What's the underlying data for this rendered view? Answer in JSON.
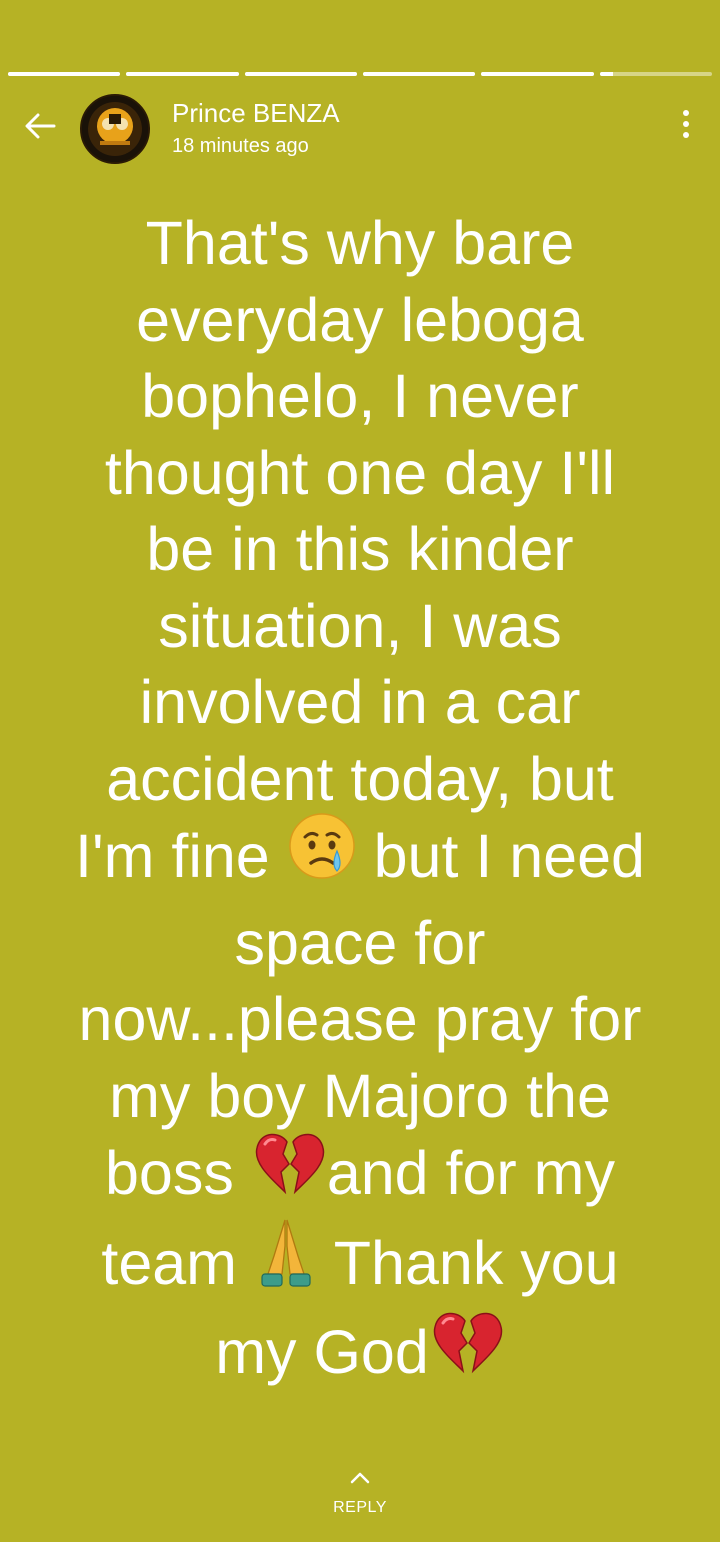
{
  "theme": {
    "background": "#b6b225",
    "text": "#ffffff"
  },
  "progress": {
    "segments": [
      {
        "state": "viewed",
        "fill": 1.0
      },
      {
        "state": "viewed",
        "fill": 1.0
      },
      {
        "state": "viewed",
        "fill": 1.0
      },
      {
        "state": "viewed",
        "fill": 1.0
      },
      {
        "state": "viewed",
        "fill": 1.0
      },
      {
        "state": "current",
        "fill": 0.12
      }
    ]
  },
  "header": {
    "back_icon": "arrow-left-icon",
    "avatar_icon": "profile-avatar",
    "name": "Prince BENZA",
    "timestamp": "18 minutes ago",
    "menu_icon": "more-vertical-icon"
  },
  "status": {
    "parts": [
      {
        "type": "text",
        "value": "That's why bare\neveryday leboga\nbophelo, I never\nthought one day I'll\nbe in this kinder\nsituation, I was\ninvolved in a car\naccident today, but\nI'm fine  "
      },
      {
        "type": "emoji",
        "icon": "crying-face-emoji"
      },
      {
        "type": "text",
        "value": " but I need\nspace for\nnow...please pray for\nmy boy Majoro the\nboss "
      },
      {
        "type": "emoji",
        "icon": "broken-heart-emoji"
      },
      {
        "type": "text",
        "value": "and for my\nteam "
      },
      {
        "type": "emoji",
        "icon": "folded-hands-emoji"
      },
      {
        "type": "text",
        "value": " Thank you\nmy God"
      },
      {
        "type": "emoji",
        "icon": "broken-heart-emoji"
      }
    ]
  },
  "footer": {
    "reply_icon": "chevron-up-icon",
    "reply_label": "REPLY"
  }
}
